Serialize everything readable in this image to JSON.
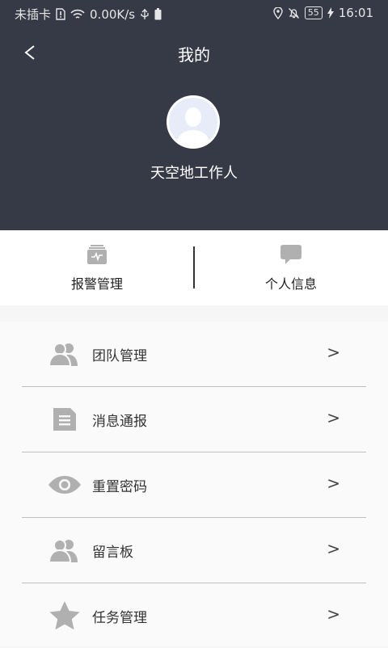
{
  "status_bar": {
    "carrier": "未插卡",
    "speed": "0.00K/s",
    "battery": "55",
    "time": "16:01"
  },
  "header": {
    "back_glyph": "<",
    "title": "我的"
  },
  "user": {
    "name": "天空地工作人"
  },
  "quick_actions": [
    {
      "label": "报警管理",
      "icon": "alarm-clipboard-icon"
    },
    {
      "label": "个人信息",
      "icon": "chat-bubble-icon"
    }
  ],
  "menu": {
    "items": [
      {
        "label": "团队管理",
        "icon": "team-icon",
        "arrow": ">"
      },
      {
        "label": "消息通报",
        "icon": "document-icon",
        "arrow": ">"
      },
      {
        "label": "重置密码",
        "icon": "eye-icon",
        "arrow": ">"
      },
      {
        "label": "留言板",
        "icon": "people-icon",
        "arrow": ">"
      },
      {
        "label": "任务管理",
        "icon": "star-icon",
        "arrow": ">"
      }
    ]
  },
  "colors": {
    "header_bg": "#363a47",
    "icon_gray": "#b0b0b0"
  }
}
